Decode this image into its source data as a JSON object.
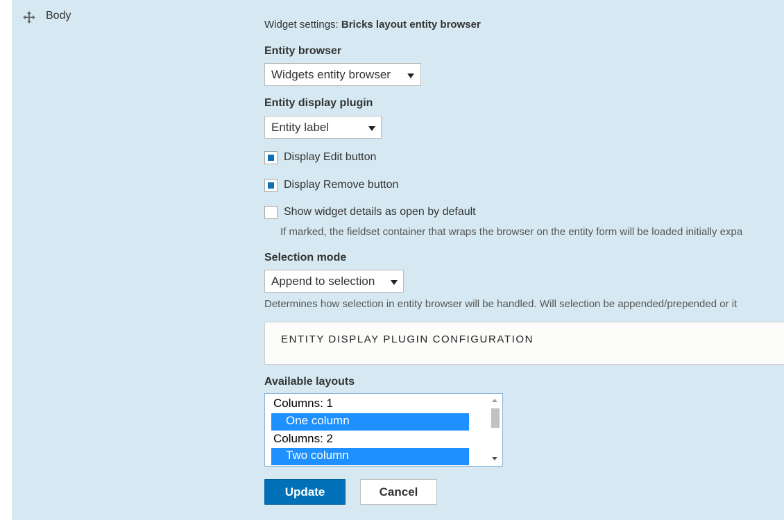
{
  "row": {
    "drag_icon": "move-arrows-icon",
    "label": "Body"
  },
  "widget_settings": {
    "prefix": "Widget settings: ",
    "name": "Bricks layout entity browser"
  },
  "entity_browser": {
    "label": "Entity browser",
    "value": "Widgets entity browser"
  },
  "entity_display_plugin": {
    "label": "Entity display plugin",
    "value": "Entity label"
  },
  "checkboxes": [
    {
      "label": "Display Edit button",
      "checked": true
    },
    {
      "label": "Display Remove button",
      "checked": true
    },
    {
      "label": "Show widget details as open by default",
      "checked": false
    }
  ],
  "open_default_description": "If marked, the fieldset container that wraps the browser on the entity form will be loaded initially expa",
  "selection_mode": {
    "label": "Selection mode",
    "value": "Append to selection",
    "description": "Determines how selection in entity browser will be handled. Will selection be appended/prepended or it"
  },
  "plugin_config": {
    "legend": "ENTITY DISPLAY PLUGIN CONFIGURATION"
  },
  "available_layouts": {
    "label": "Available layouts",
    "groups": [
      {
        "label": "Columns: 1",
        "options": [
          {
            "label": "One column",
            "selected": true
          }
        ]
      },
      {
        "label": "Columns: 2",
        "options": [
          {
            "label": "Two column",
            "selected": true
          }
        ]
      }
    ]
  },
  "buttons": {
    "update": "Update",
    "cancel": "Cancel"
  },
  "colors": {
    "panel_bg": "#d6e9f2",
    "primary": "#0071b8",
    "checkbox_fill": "#0f6fb5",
    "selected_option": "#1e90ff"
  }
}
